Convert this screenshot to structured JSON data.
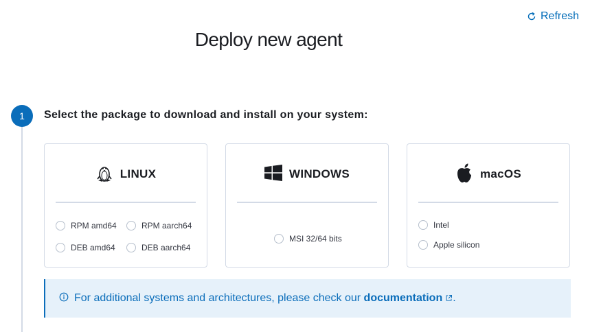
{
  "header": {
    "refresh_label": "Refresh",
    "title": "Deploy new agent"
  },
  "step": {
    "number": "1",
    "title": "Select the package to download and install on your system:"
  },
  "cards": {
    "linux": {
      "title": "LINUX",
      "options": [
        "RPM amd64",
        "RPM aarch64",
        "DEB amd64",
        "DEB aarch64"
      ]
    },
    "windows": {
      "title": "WINDOWS",
      "options": [
        "MSI 32/64 bits"
      ]
    },
    "macos": {
      "title": "macOS",
      "options": [
        "Intel",
        "Apple silicon"
      ]
    }
  },
  "callout": {
    "text_before": "For additional systems and architectures, please check our",
    "link_text": "documentation",
    "text_after": "."
  },
  "colors": {
    "accent": "#0a6dba",
    "callout_bg": "#e6f1fa",
    "border": "#d3dae6"
  }
}
